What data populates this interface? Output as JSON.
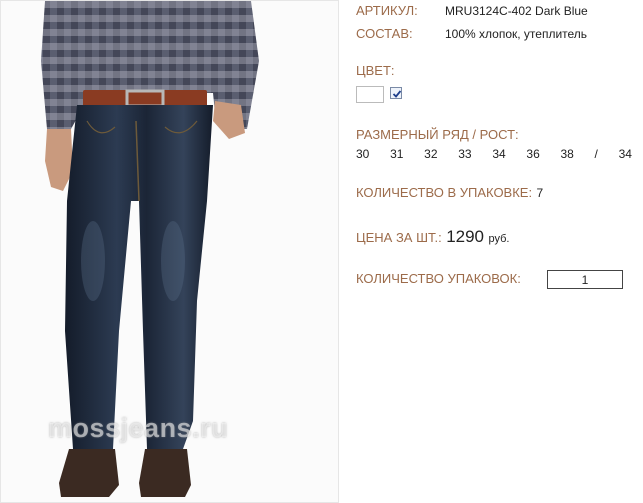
{
  "product": {
    "photo_alt": "Dark blue men's jeans",
    "watermark": "mossjeans.ru"
  },
  "details": {
    "article_label": "АРТИКУЛ:",
    "article_value": "MRU3124C-402 Dark Blue",
    "composition_label": "СОСТАВ:",
    "composition_value": "100% хлопок, утеплитель",
    "color_label": "ЦВЕТ:",
    "color_checked": true,
    "sizes_label": "РАЗМЕРНЫЙ РЯД / РОСТ:",
    "sizes": [
      "30",
      "31",
      "32",
      "33",
      "34",
      "36",
      "38",
      "/",
      "34"
    ],
    "pack_qty_label": "КОЛИЧЕСТВО В УПАКОВКЕ:",
    "pack_qty_value": "7",
    "price_label": "ЦЕНА ЗА ШТ.:",
    "price_value": "1290",
    "price_unit": "руб.",
    "packs_label": "КОЛИЧЕСТВО УПАКОВОК:",
    "packs_value": "1"
  },
  "colors": {
    "label": "#9c6b4a",
    "denim": "#1d2a3d",
    "belt": "#8a3b22"
  }
}
